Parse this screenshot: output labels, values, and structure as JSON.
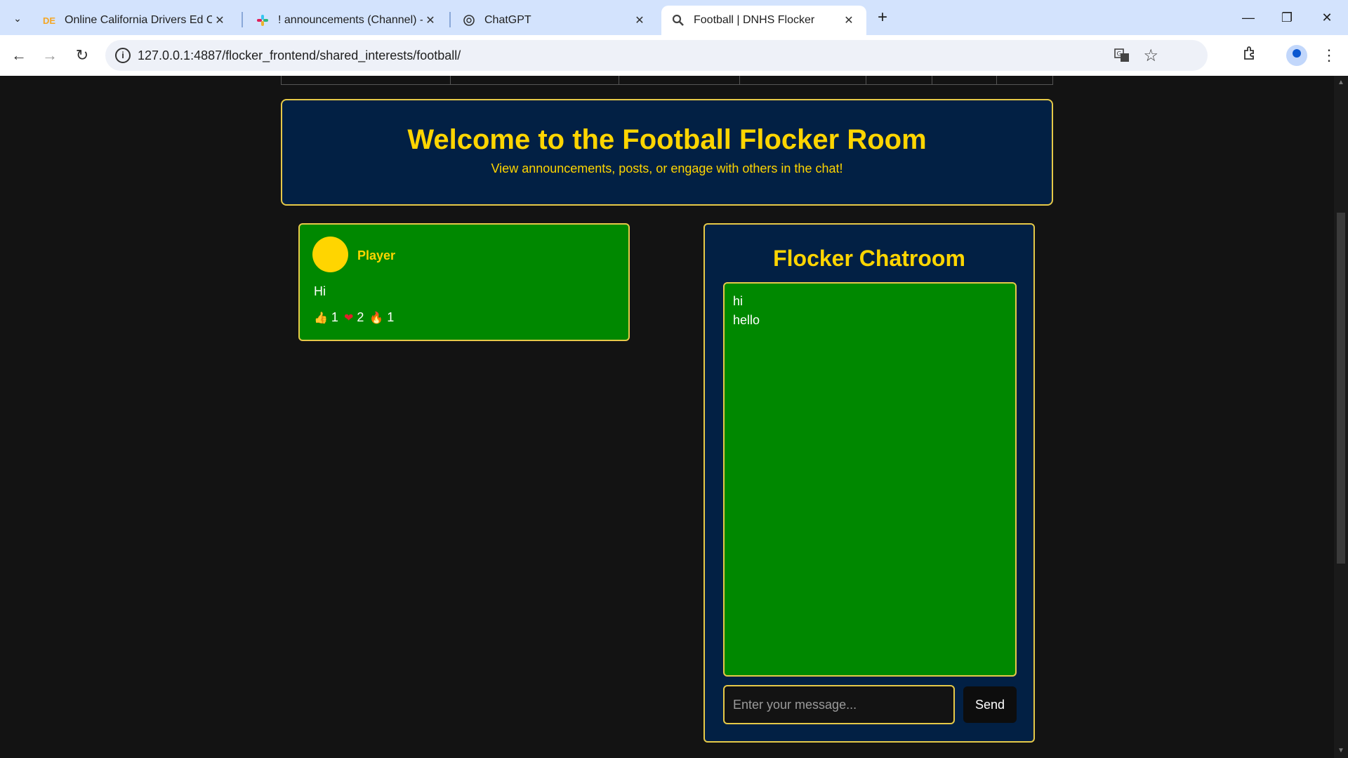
{
  "browser": {
    "tabs": [
      {
        "title": "Online California Drivers Ed Cou",
        "favicon": "DE",
        "active": false
      },
      {
        "title": "! announcements (Channel) - C",
        "favicon": "slack",
        "active": false
      },
      {
        "title": "ChatGPT",
        "favicon": "chatgpt",
        "active": false
      },
      {
        "title": "Football | DNHS Flocker",
        "favicon": "search",
        "active": true
      }
    ],
    "url": "127.0.0.1:4887/flocker_frontend/shared_interests/football/"
  },
  "header": {
    "title": "Welcome to the Football Flocker Room",
    "subtitle": "View announcements, posts, or engage with others in the chat!"
  },
  "post": {
    "author": "Player",
    "text": "Hi",
    "reactions": [
      {
        "icon": "thumbs-up-icon",
        "glyph": "👍",
        "count": "1"
      },
      {
        "icon": "heart-icon",
        "glyph": "❤",
        "count": "2"
      },
      {
        "icon": "fire-icon",
        "glyph": "🔥",
        "count": "1"
      }
    ]
  },
  "chat": {
    "title": "Flocker Chatroom",
    "messages": [
      "hi",
      "hello"
    ],
    "placeholder": "Enter your message...",
    "send_label": "Send"
  },
  "colors": {
    "accent": "#ffd500",
    "panel": "#022044",
    "green": "#008800",
    "background": "#131313"
  }
}
